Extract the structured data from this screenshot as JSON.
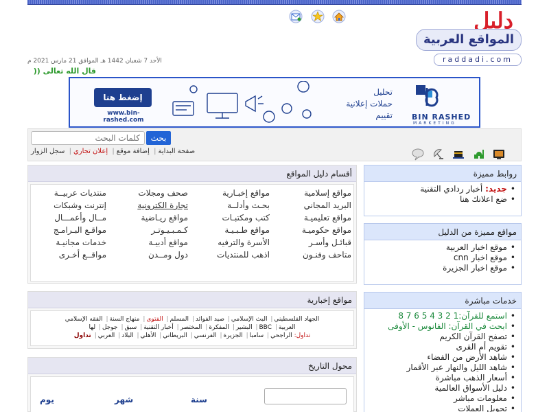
{
  "header": {
    "icons": [
      "home-icon",
      "star-icon",
      "email-icon"
    ],
    "logo_top": "دليل",
    "logo_main": "المواقع العربية",
    "logo_domain": "raddadi.com",
    "date": "الأحد 7 شعبان 1442 هـ الموافق 21 مارس 2021 م",
    "quote": "قال الله تعالى ((  ("
  },
  "banner": {
    "button_label": "إضغط هنا",
    "url": "www.bin-rashed.com",
    "items": [
      "تحليل",
      "حملات إعلانية",
      "تقييم"
    ],
    "brand": "BIN RASHED",
    "brand_sub": "MARKETING"
  },
  "navbar": {
    "search_placeholder": "كلمات البحث",
    "search_button": "بحث",
    "links": [
      "صفحة البداية",
      "إضافة موقع",
      "إعلان تجاري",
      "سجل الزوار"
    ],
    "icons": [
      "tv-icon",
      "mosque-icon",
      "kaaba-icon",
      "satellite-dish-icon",
      "chat-bubble-icon"
    ]
  },
  "categories": {
    "title": "أقسام دليل المواقع",
    "columns": [
      [
        "مواقع إسلامية",
        "البريد المجاني",
        "مواقع تعليميـة",
        "مواقع حكوميـة",
        "قبائـل وأسـر",
        "متاحف وفنـون"
      ],
      [
        "مواقع إخبـارية",
        "بحـث وأدلــة",
        "كتب ومكتبـات",
        "مواقع طـبـيـة",
        "الأسرة والترفيه",
        "اذهب للمنتديات"
      ],
      [
        "صحف ومجلات",
        "تجارة الكترونية",
        "مواقع ريـاضية",
        "كـمـبـيـوتـر",
        "مواقع أدبيـة",
        "دول ومــدن"
      ],
      [
        "منتديات عربيــة",
        "إنترنت وشبكات",
        "مــال وأعمـــال",
        "مواقـع البـرامـج",
        "خدمات مجانيـة",
        "مواقــع أخـرى"
      ]
    ]
  },
  "news": {
    "title": "مواقع إخبارية",
    "line1": [
      "الجهاد الفلسطيني",
      "البث الإسلامي",
      "صيد الفوائد",
      "المسلم",
      "الفتوى",
      "منهاج السنة",
      "الفقه الإسلامي"
    ],
    "line2": [
      "العربية",
      "BBC",
      "البشير",
      "المفكرة",
      "المختصر",
      "أخبار التقنية",
      "سبق",
      "جوجل",
      "لها"
    ],
    "line3": [
      "تداول:",
      "الراجحي",
      "سامبا",
      "الجزيرة",
      "الفرنسي",
      "البريطاني",
      "الأهلي",
      "البلاد",
      "العربي",
      "تداول"
    ]
  },
  "converter": {
    "title": "محول التاريخ",
    "year": "سنة",
    "month": "شهر",
    "day": "يوم"
  },
  "featured_links": {
    "title": "روابط مميزة",
    "items": [
      {
        "prefix": "جديد:",
        "text": "أخبار ردادي التقنية"
      },
      {
        "prefix": "",
        "text": "ضع اعلانك هنا"
      }
    ]
  },
  "featured_sites": {
    "title": "مواقع مميزة من الدليل",
    "items": [
      "موقع اخبار العربية",
      "موقع اخبار cnn",
      "موقع اخبار الجزيرة"
    ]
  },
  "live_services": {
    "title": "خدمات مباشرة",
    "items": [
      "استمع للقرآن:1  2  3  4  5  6  7  8",
      "ابحث في القرآن: الفانوس  - الأوفى",
      "تصفح القرآن الكريم",
      "تقويم أم القرى",
      "شاهد الأرض من الفضاء",
      "شاهد الليل والنهار عبر الأقمار",
      "أسعار الذهب مباشرة",
      "دليل الأسواق العالمية",
      "معلومات مباشر",
      "تحويل العملات"
    ]
  }
}
